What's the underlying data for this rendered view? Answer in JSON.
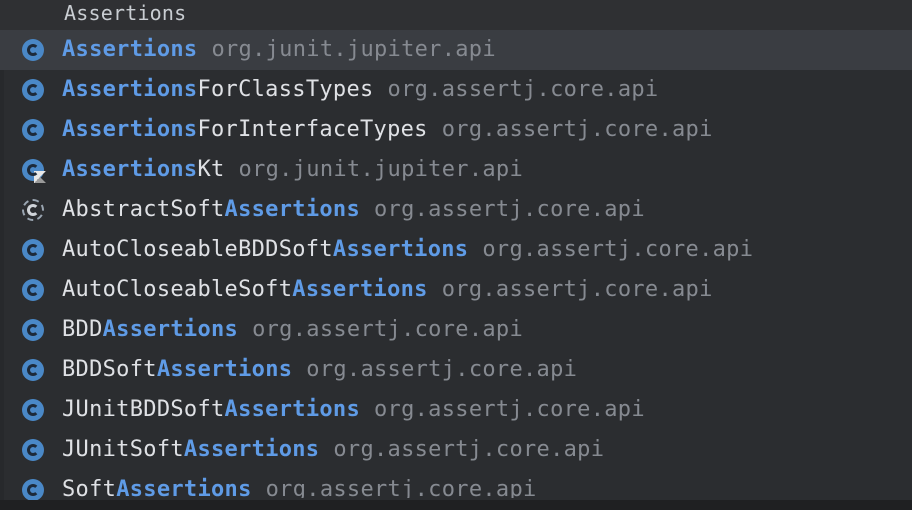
{
  "query": "Assertions",
  "items": [
    {
      "icon": "class-icon",
      "parts": [
        {
          "t": "Assertions",
          "m": true
        }
      ],
      "pkg": "org.junit.jupiter.api",
      "selected": true
    },
    {
      "icon": "class-icon",
      "parts": [
        {
          "t": "Assertions",
          "m": true
        },
        {
          "t": "ForClassTypes",
          "m": false
        }
      ],
      "pkg": "org.assertj.core.api"
    },
    {
      "icon": "class-icon",
      "parts": [
        {
          "t": "Assertions",
          "m": true
        },
        {
          "t": "ForInterfaceTypes",
          "m": false
        }
      ],
      "pkg": "org.assertj.core.api"
    },
    {
      "icon": "kotlin-class-icon",
      "parts": [
        {
          "t": "Assertions",
          "m": true
        },
        {
          "t": "Kt",
          "m": false
        }
      ],
      "pkg": "org.junit.jupiter.api"
    },
    {
      "icon": "abstract-class-icon",
      "parts": [
        {
          "t": "AbstractSoft",
          "m": false
        },
        {
          "t": "Assertions",
          "m": true
        }
      ],
      "pkg": "org.assertj.core.api"
    },
    {
      "icon": "class-icon",
      "parts": [
        {
          "t": "AutoCloseableBDDSoft",
          "m": false
        },
        {
          "t": "Assertions",
          "m": true
        }
      ],
      "pkg": "org.assertj.core.api"
    },
    {
      "icon": "class-icon",
      "parts": [
        {
          "t": "AutoCloseableSoft",
          "m": false
        },
        {
          "t": "Assertions",
          "m": true
        }
      ],
      "pkg": "org.assertj.core.api"
    },
    {
      "icon": "class-icon",
      "parts": [
        {
          "t": "BDD",
          "m": false
        },
        {
          "t": "Assertions",
          "m": true
        }
      ],
      "pkg": "org.assertj.core.api"
    },
    {
      "icon": "class-icon",
      "parts": [
        {
          "t": "BDDSoft",
          "m": false
        },
        {
          "t": "Assertions",
          "m": true
        }
      ],
      "pkg": "org.assertj.core.api"
    },
    {
      "icon": "class-icon",
      "parts": [
        {
          "t": "JUnitBDDSoft",
          "m": false
        },
        {
          "t": "Assertions",
          "m": true
        }
      ],
      "pkg": "org.assertj.core.api"
    },
    {
      "icon": "class-icon",
      "parts": [
        {
          "t": "JUnitSoft",
          "m": false
        },
        {
          "t": "Assertions",
          "m": true
        }
      ],
      "pkg": "org.assertj.core.api"
    },
    {
      "icon": "class-icon",
      "parts": [
        {
          "t": "Soft",
          "m": false
        },
        {
          "t": "Assertions",
          "m": true
        }
      ],
      "pkg": "org.assertj.core.api",
      "cut": true
    }
  ]
}
